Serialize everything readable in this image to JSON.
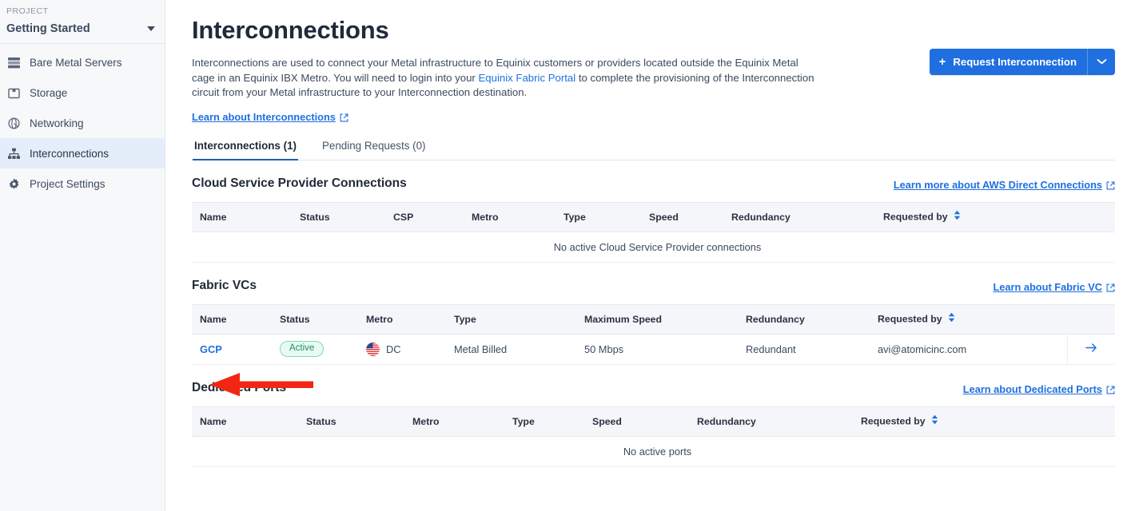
{
  "sidebar": {
    "project_label": "PROJECT",
    "project_name": "Getting Started",
    "caret_icon": "chevron-down-icon",
    "items": [
      {
        "label": "Bare Metal Servers",
        "icon": "server-icon",
        "active": false
      },
      {
        "label": "Storage",
        "icon": "storage-box-icon",
        "active": false
      },
      {
        "label": "Networking",
        "icon": "network-globe-icon",
        "active": false
      },
      {
        "label": "Interconnections",
        "icon": "interconnections-hierarchy-icon",
        "active": true
      },
      {
        "label": "Project Settings",
        "icon": "gear-icon",
        "active": false
      }
    ]
  },
  "header": {
    "title": "Interconnections",
    "intro_part_1": "Interconnections are used to connect your Metal infrastructure to Equinix customers or providers located outside the Equinix Metal cage in an Equinix IBX Metro. You will need to login into your ",
    "intro_link": "Equinix Fabric Portal",
    "intro_part_2": " to complete the provisioning of the Interconnection circuit from your Metal infrastructure to your Interconnection destination.",
    "learn_link": "Learn about Interconnections",
    "external_icon": "external-link-icon",
    "request_button": "Request Interconnection",
    "request_button_plus_icon": "plus-icon",
    "request_button_split_icon": "chevron-down-icon",
    "accent_color": "#1f6fe0"
  },
  "tabs": [
    {
      "label": "Interconnections (1)",
      "active": true
    },
    {
      "label": "Pending Requests (0)",
      "active": false
    }
  ],
  "sections": [
    {
      "title": "Cloud Service Provider Connections",
      "learn_link": "Learn more about AWS Direct Connections",
      "external_icon": "external-link-icon",
      "columns": [
        "Name",
        "Status",
        "CSP",
        "Metro",
        "Type",
        "Speed",
        "Redundancy",
        "Requested by"
      ],
      "sort_column": "Requested by",
      "sort_icon": "sort-updown-icon",
      "rows": [],
      "empty_text": "No active Cloud Service Provider connections"
    },
    {
      "title": "Fabric VCs",
      "learn_link": "Learn about Fabric VC",
      "external_icon": "external-link-icon",
      "columns": [
        "Name",
        "Status",
        "Metro",
        "Type",
        "Maximum Speed",
        "Redundancy",
        "Requested by"
      ],
      "sort_column": "Requested by",
      "sort_icon": "sort-updown-icon",
      "rows": [
        {
          "name": "GCP",
          "status": "Active",
          "status_color": "#1f8f63",
          "metro_flag_icon": "us-flag-icon",
          "metro": "DC",
          "type": "Metal Billed",
          "maximum_speed": "50 Mbps",
          "redundancy": "Redundant",
          "requested_by": "avi@atomicinc.com",
          "go_icon": "arrow-right-icon"
        }
      ],
      "empty_text": ""
    },
    {
      "title": "Dedicated Ports",
      "learn_link": "Learn about Dedicated Ports",
      "external_icon": "external-link-icon",
      "columns": [
        "Name",
        "Status",
        "Metro",
        "Type",
        "Speed",
        "Redundancy",
        "Requested by"
      ],
      "sort_column": "Requested by",
      "sort_icon": "sort-updown-icon",
      "rows": [],
      "empty_text": "No active ports"
    }
  ],
  "annotation": {
    "type": "arrow",
    "color": "#f22613",
    "points_to": "status-badge-active",
    "direction": "left"
  }
}
